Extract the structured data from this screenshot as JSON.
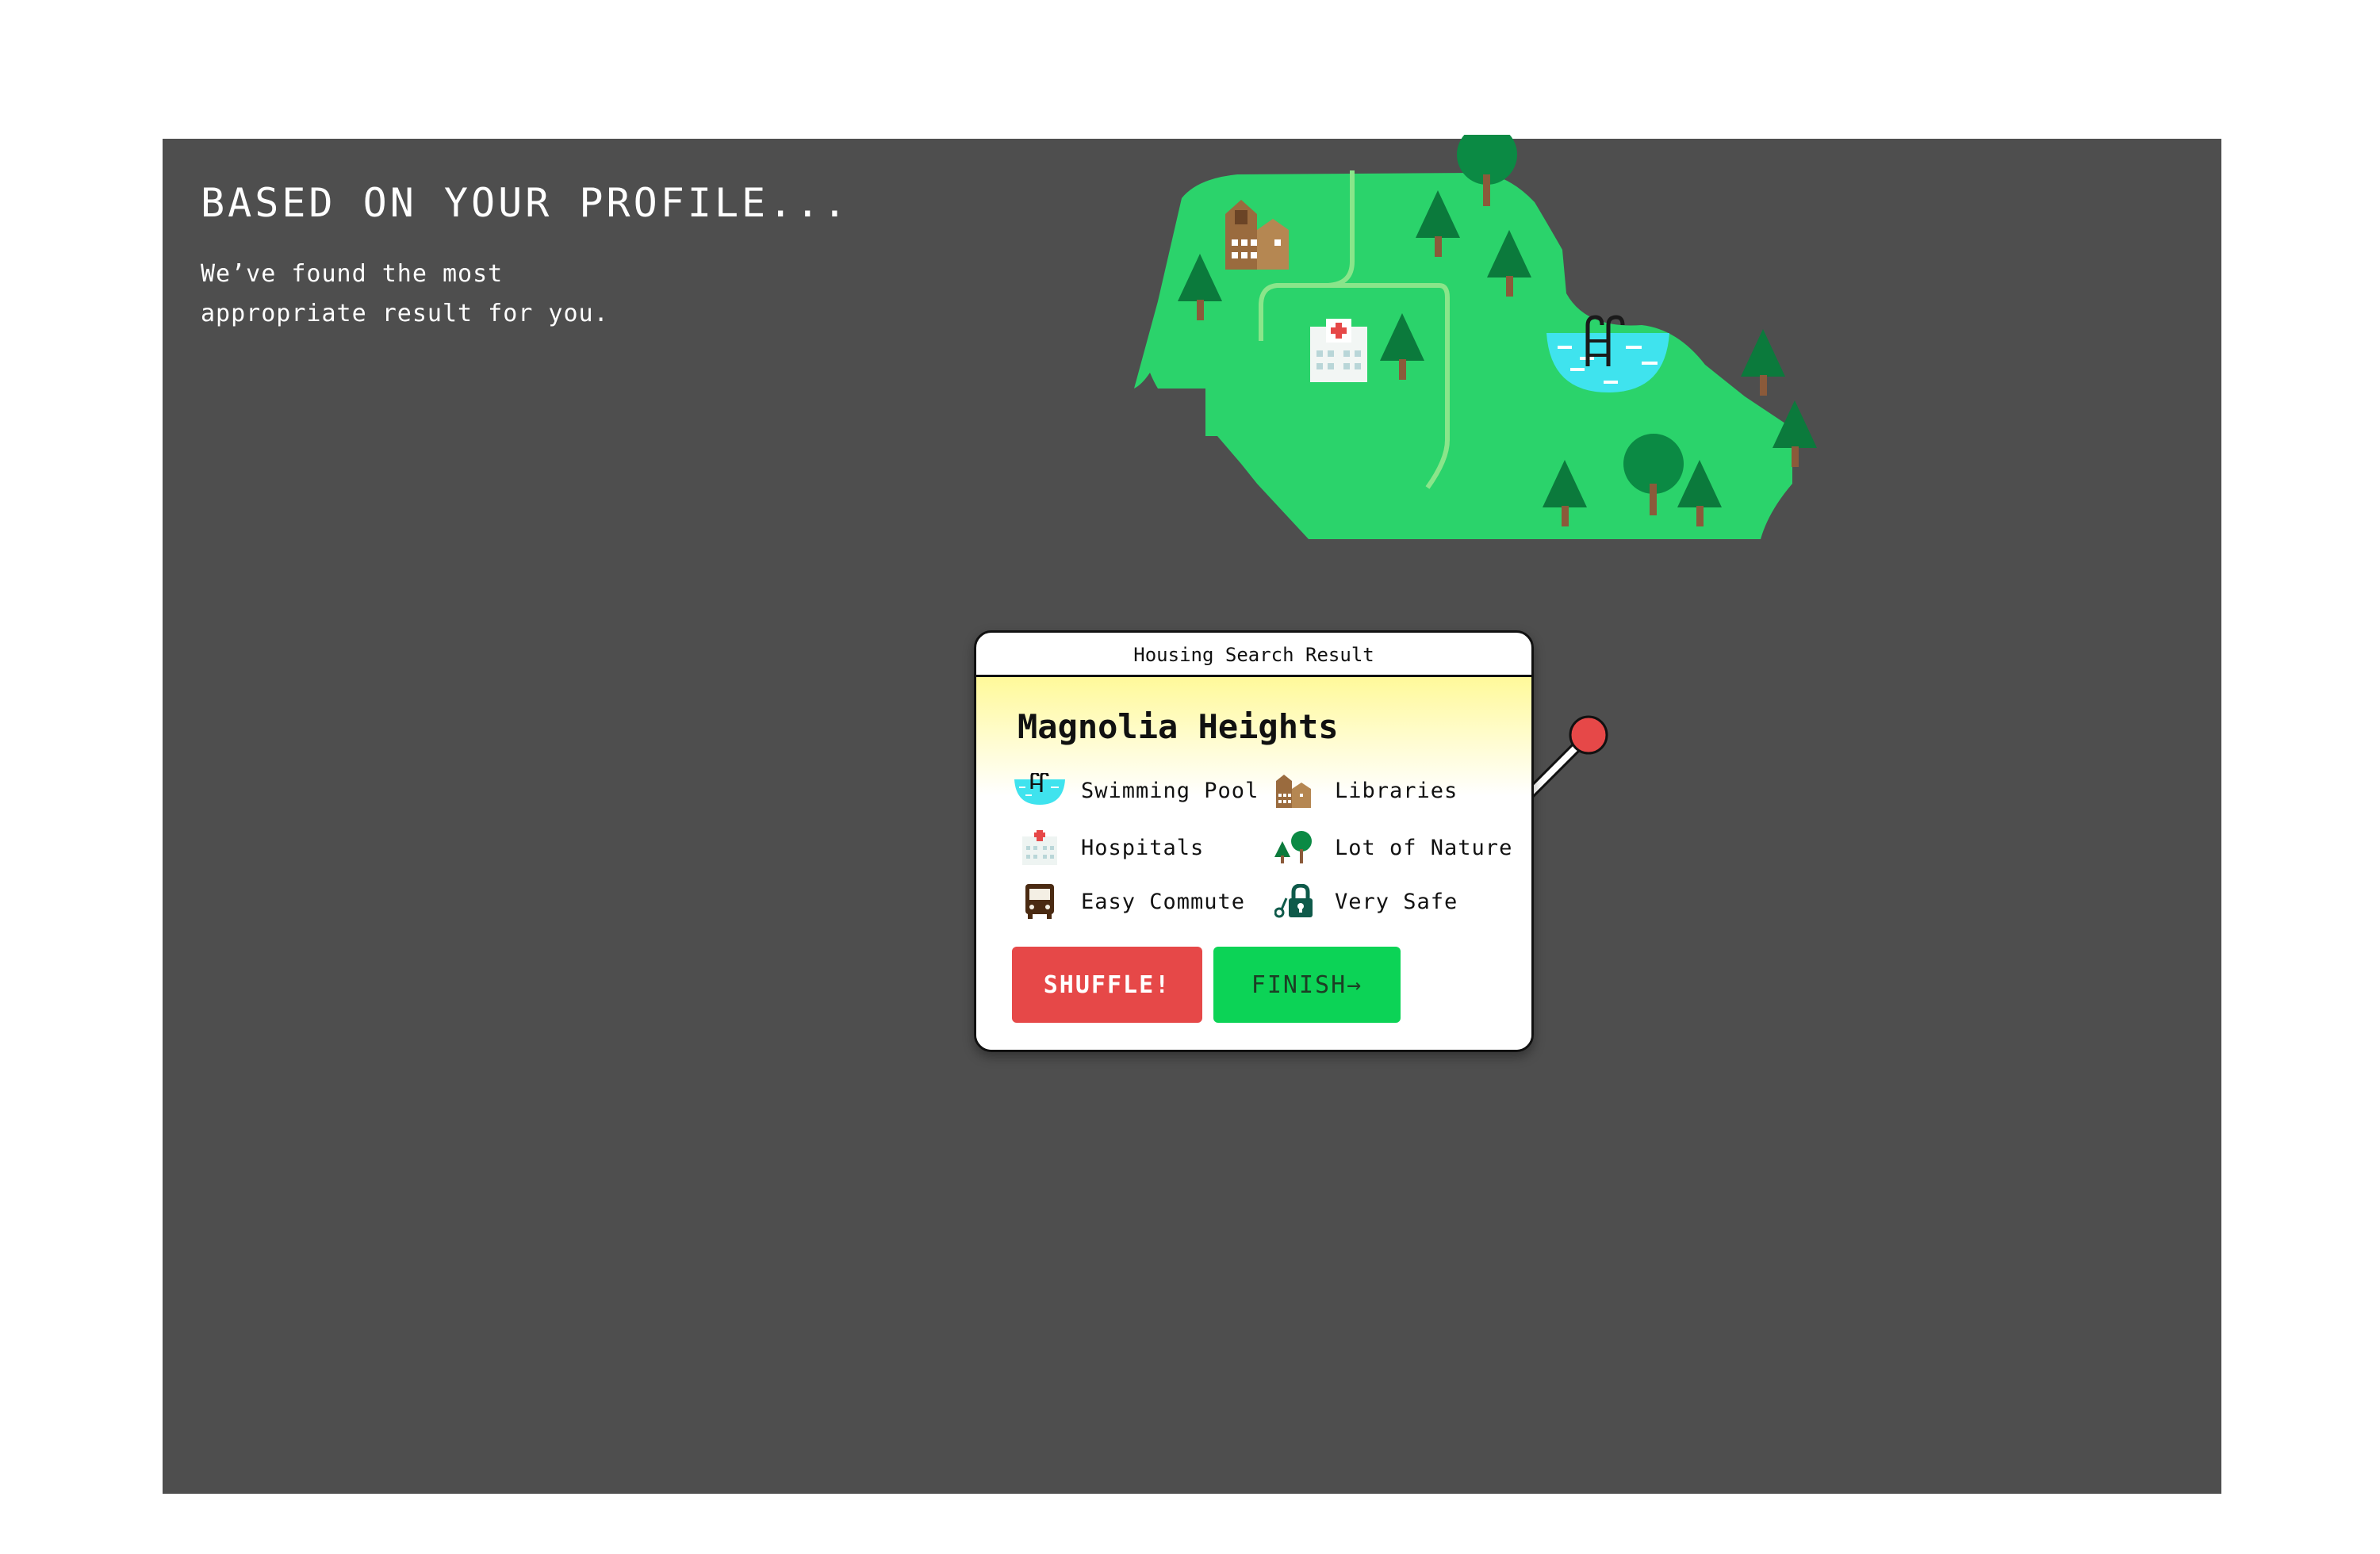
{
  "header": {
    "title": "BASED ON YOUR PROFILE...",
    "subtitle_line1": "We’ve found the most",
    "subtitle_line2": "appropriate result for you."
  },
  "result_card": {
    "window_title": "Housing Search Result",
    "place_name": "Magnolia Heights",
    "amenities": [
      {
        "label": "Swimming Pool",
        "icon": "swimming-pool-icon"
      },
      {
        "label": "Libraries",
        "icon": "library-icon"
      },
      {
        "label": "Hospitals",
        "icon": "hospital-icon"
      },
      {
        "label": "Lot of Nature",
        "icon": "trees-icon"
      },
      {
        "label": "Easy Commute",
        "icon": "bus-icon"
      },
      {
        "label": "Very Safe",
        "icon": "lock-icon"
      }
    ],
    "shuffle_label": "SHUFFLE!",
    "finish_label": "FINISH→"
  },
  "colors": {
    "panel_bg": "#4e4e4e",
    "map_green": "#2bd36b",
    "tree_dark": "#0b7a3c",
    "water": "#3fe3ee",
    "shuffle": "#e64848",
    "finish": "#0cd356",
    "pin_red": "#e64848"
  }
}
